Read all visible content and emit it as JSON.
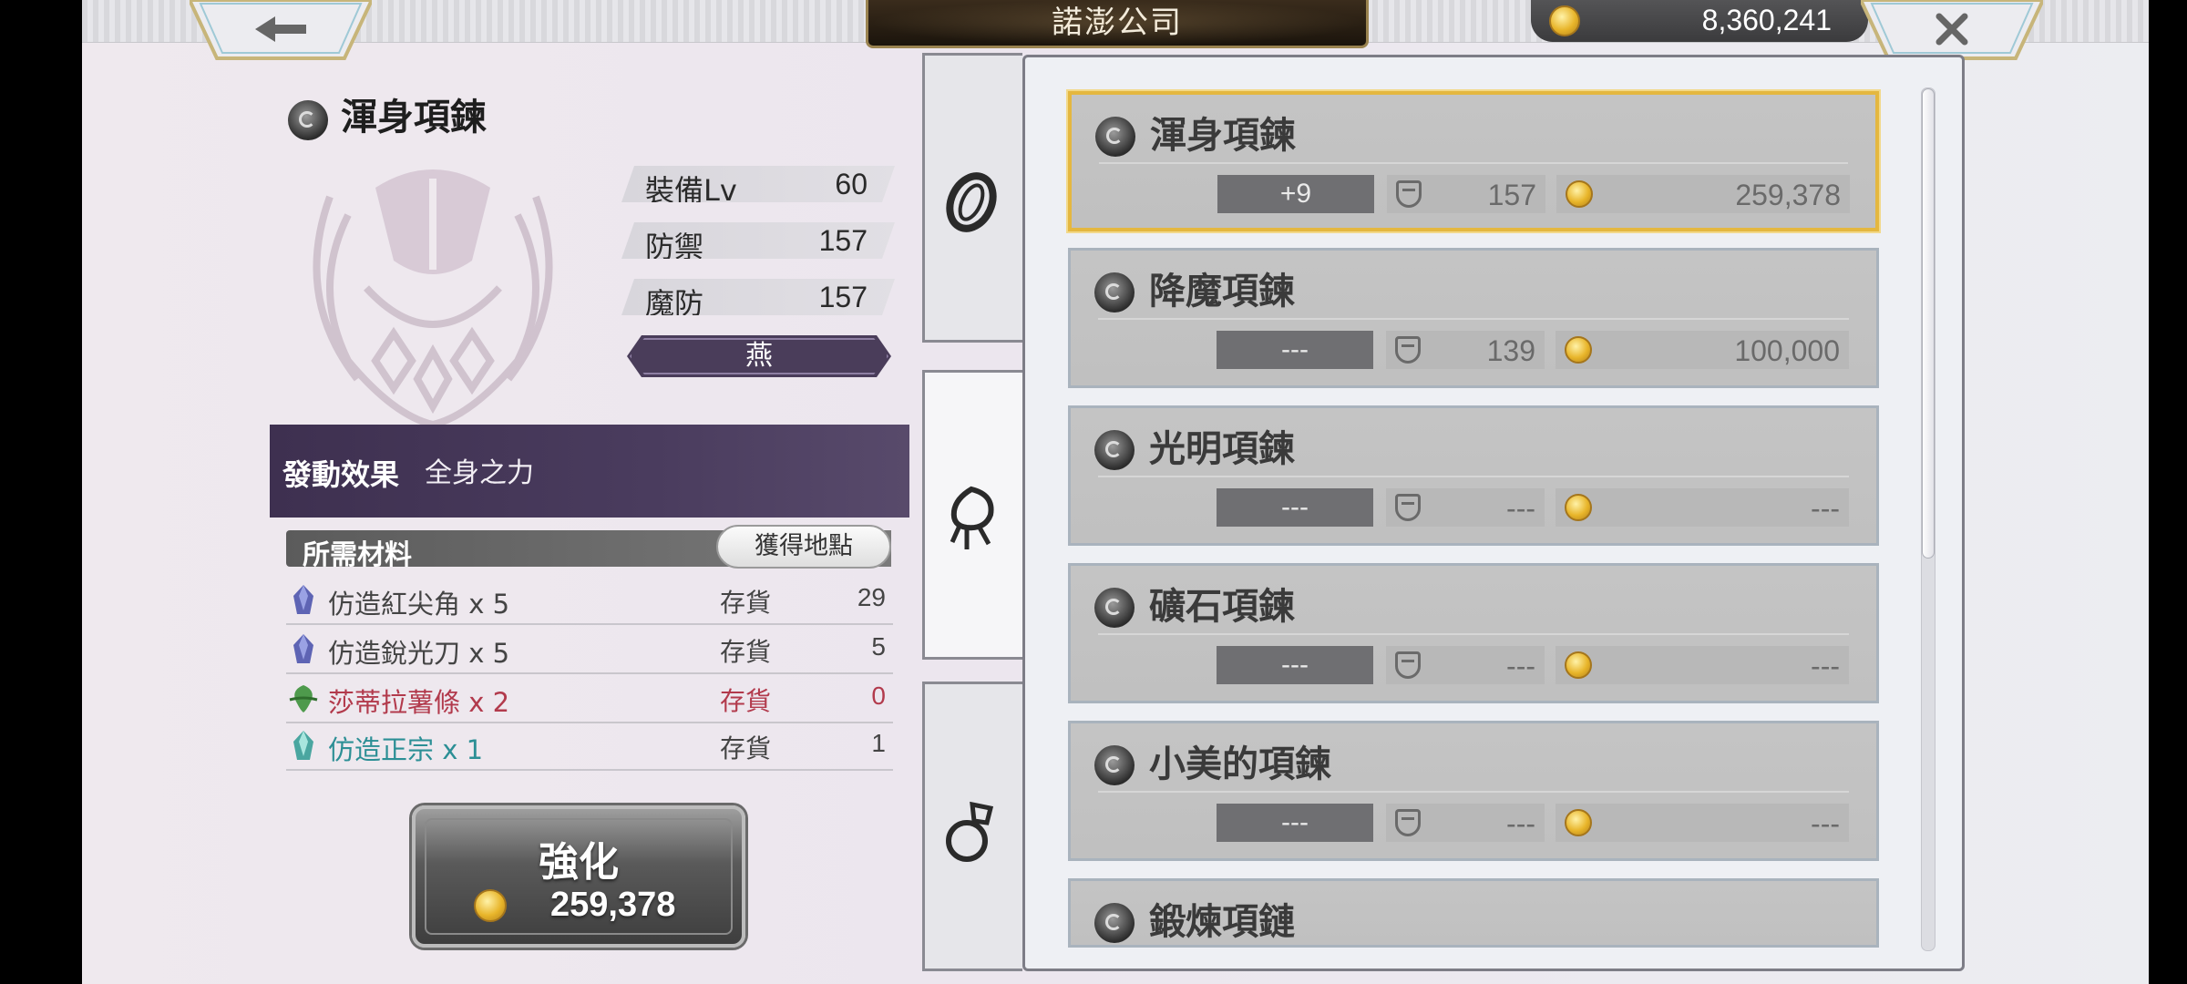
{
  "header": {
    "title": "諾澎公司",
    "gold": "8,360,241",
    "back_icon": "arrow-left-icon",
    "close_icon": "close-icon"
  },
  "detail": {
    "name": "渾身項鍊",
    "stats": [
      {
        "label": "裝備Lv",
        "value": "60"
      },
      {
        "label": "防禦",
        "value": "157"
      },
      {
        "label": "魔防",
        "value": "157"
      }
    ],
    "character": "燕",
    "effect_label": "發動效果",
    "effect_value": "全身之力"
  },
  "materials": {
    "header": "所需材料",
    "location_button": "獲得地點",
    "rows": [
      {
        "name": "仿造紅尖角 x 5",
        "stock_label": "存貨",
        "count": "29"
      },
      {
        "name": "仿造銳光刀 x 5",
        "stock_label": "存貨",
        "count": "5"
      },
      {
        "name": "莎蒂拉薯條 x 2",
        "stock_label": "存貨",
        "count": "0"
      },
      {
        "name": "仿造正宗 x 1",
        "stock_label": "存貨",
        "count": "1"
      }
    ]
  },
  "enhance": {
    "label": "強化",
    "cost": "259,378"
  },
  "tabs": [
    {
      "name": "bracelet-tab",
      "icon": "bracelet-icon"
    },
    {
      "name": "necklace-tab",
      "icon": "necklace-icon"
    },
    {
      "name": "ring-tab",
      "icon": "ring-icon"
    }
  ],
  "list": [
    {
      "name": "渾身項鍊",
      "level": "+9",
      "defense": "157",
      "price": "259,378"
    },
    {
      "name": "降魔項鍊",
      "level": "---",
      "defense": "139",
      "price": "100,000"
    },
    {
      "name": "光明項鍊",
      "level": "---",
      "defense": "---",
      "price": "---"
    },
    {
      "name": "礦石項鍊",
      "level": "---",
      "defense": "---",
      "price": "---"
    },
    {
      "name": "小美的項鍊",
      "level": "---",
      "defense": "---",
      "price": "---"
    },
    {
      "name": "鍛煉項鏈",
      "level": "",
      "defense": "",
      "price": ""
    }
  ],
  "colors": {
    "accent_purple": "#4a3d5a",
    "selected_border": "#e4b740",
    "shortage_red": "#b23a4c",
    "teal": "#2c8f95"
  }
}
